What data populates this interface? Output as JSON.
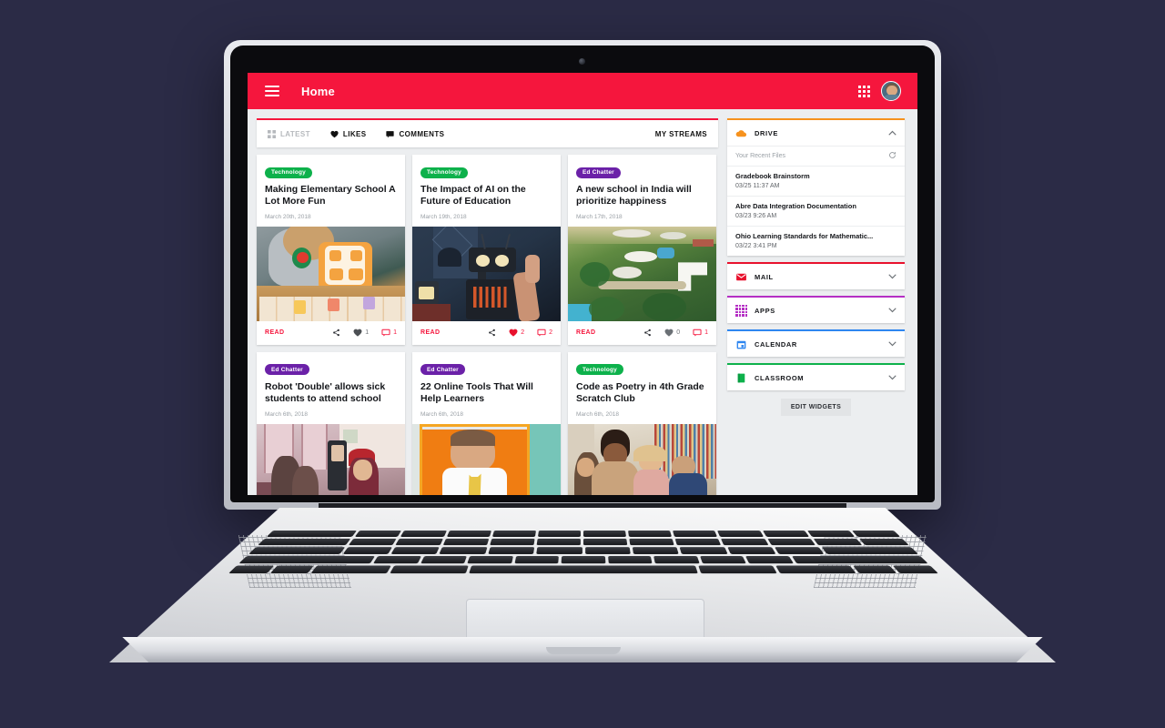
{
  "theme": {
    "brand_red": "#f5163d",
    "green": "#0db14b",
    "purple": "#6b21a8",
    "page_bg": "#2b2b46"
  },
  "appbar": {
    "menu_icon": "hamburger-menu-icon",
    "title": "Home",
    "apps_icon": "apps-grid-icon",
    "avatar_icon": "user-avatar"
  },
  "tabs": [
    {
      "label": "LATEST",
      "icon": "grid-tiles-icon",
      "active": false
    },
    {
      "label": "LIKES",
      "icon": "heart-icon",
      "active": true
    },
    {
      "label": "COMMENTS",
      "icon": "comment-icon",
      "active": true
    }
  ],
  "my_streams_label": "MY STREAMS",
  "cards": [
    {
      "tag": "Technology",
      "tag_type": "technology",
      "title": "Making Elementary School A Lot More Fun",
      "date": "March 20th, 2018",
      "image": "child-with-orange-robot-toy-and-alphabet-blocks",
      "read_label": "READ",
      "share_icon": "share-icon",
      "likes": "1",
      "liked": false,
      "comments": "1"
    },
    {
      "tag": "Technology",
      "tag_type": "technology",
      "title": "The Impact of AI on the Future of Education",
      "date": "March 19th, 2018",
      "image": "dark-robot-with-glowing-eyes-being-assembled",
      "read_label": "READ",
      "share_icon": "share-icon",
      "likes": "2",
      "liked": true,
      "comments": "2"
    },
    {
      "tag": "Ed Chatter",
      "tag_type": "edchatter",
      "title": "A new school in India will prioritize happiness",
      "date": "March 17th, 2018",
      "image": "aerial-view-of-green-school-campus",
      "read_label": "READ",
      "share_icon": "share-icon",
      "likes": "0",
      "liked": false,
      "comments": "1"
    },
    {
      "tag": "Ed Chatter",
      "tag_type": "edchatter",
      "title": "Robot 'Double' allows sick students to attend school",
      "date": "March 6th, 2018",
      "image": "classroom-with-telepresence-robot-and-students"
    },
    {
      "tag": "Ed Chatter",
      "tag_type": "edchatter",
      "title": "22 Online Tools That Will Help Learners",
      "date": "March 6th, 2018",
      "image": "teacher-in-front-of-orange-bulletin-board"
    },
    {
      "tag": "Technology",
      "tag_type": "technology",
      "title": "Code as Poetry in 4th Grade Scratch Club",
      "date": "March 6th, 2018",
      "image": "teacher-helping-students-at-desk-in-library"
    }
  ],
  "widgets": [
    {
      "name": "DRIVE",
      "icon": "drive-cloud-icon",
      "accent": "#f6921e",
      "chevron": "chevron-up-icon",
      "expanded": true,
      "recent_label": "Your Recent Files",
      "refresh_icon": "refresh-icon",
      "files": [
        {
          "name": "Gradebook Brainstorm",
          "time": "03/25 11:37 AM"
        },
        {
          "name": "Abre Data Integration Documentation",
          "time": "03/23 9:26 AM"
        },
        {
          "name": "Ohio Learning Standards for Mathematic...",
          "time": "03/22 3:41 PM"
        }
      ]
    },
    {
      "name": "MAIL",
      "icon": "mail-envelope-icon",
      "accent": "#e8112d",
      "chevron": "chevron-down-icon",
      "expanded": false
    },
    {
      "name": "APPS",
      "icon": "apps-dots-icon",
      "accent": "#b52fc4",
      "chevron": "chevron-down-icon",
      "expanded": false
    },
    {
      "name": "CALENDAR",
      "icon": "calendar-icon",
      "accent": "#2e86f0",
      "chevron": "chevron-down-icon",
      "expanded": false
    },
    {
      "name": "CLASSROOM",
      "icon": "classroom-icon",
      "accent": "#0db14b",
      "chevron": "chevron-down-icon",
      "expanded": false
    }
  ],
  "edit_widgets_label": "EDIT WIDGETS"
}
